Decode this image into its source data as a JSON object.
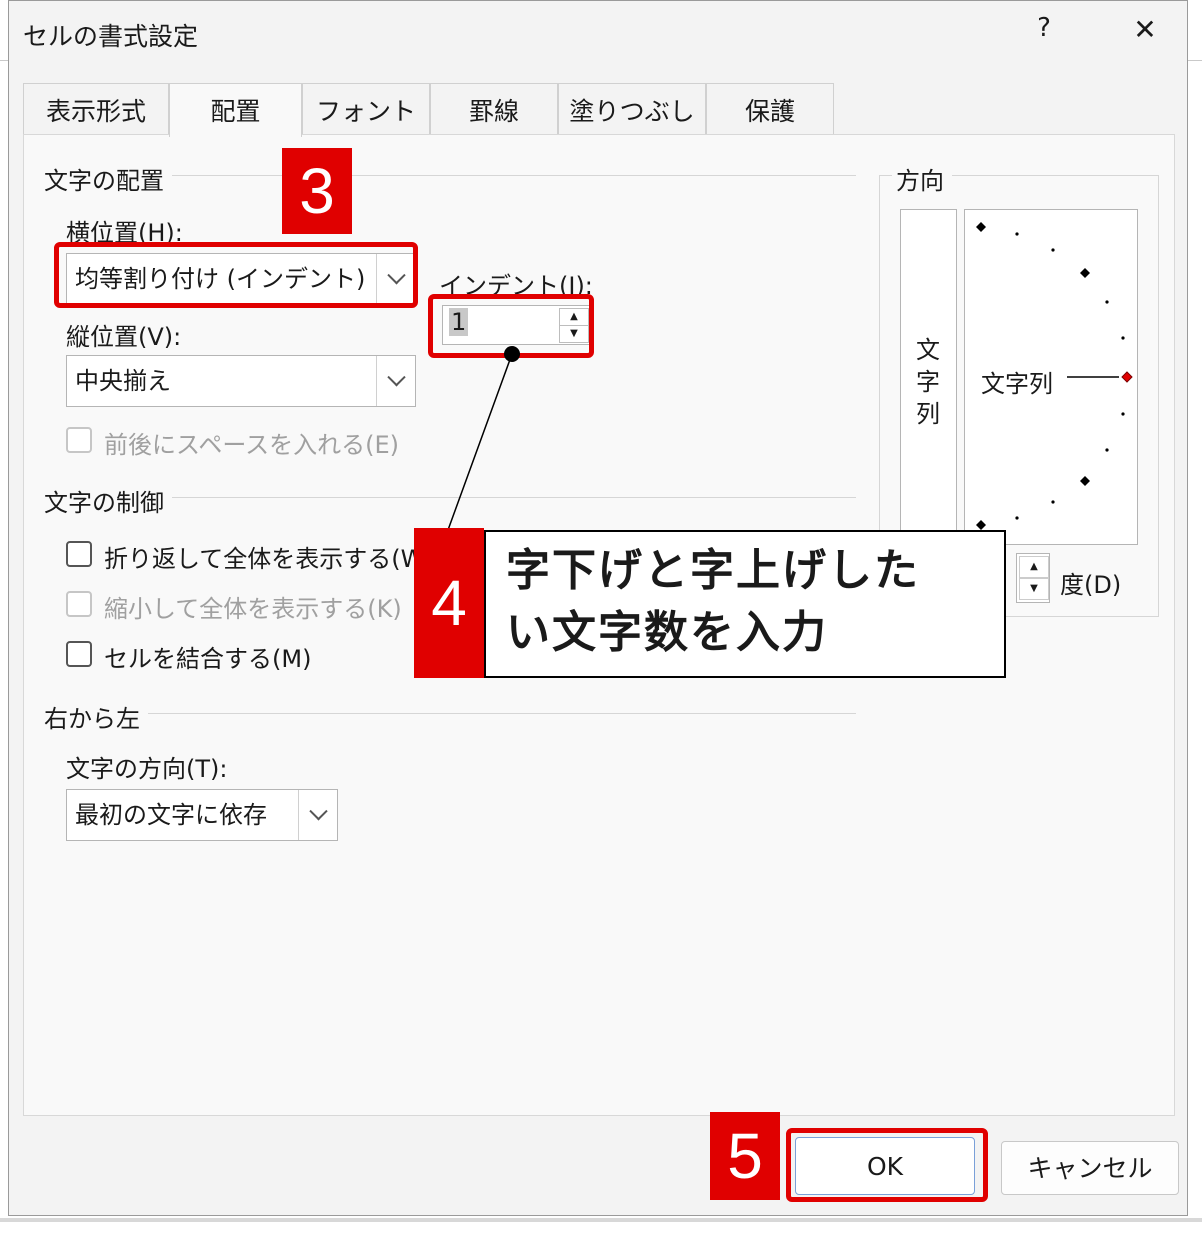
{
  "dialog": {
    "title": "セルの書式設定",
    "help_glyph": "?",
    "close_glyph": "✕"
  },
  "tabs": [
    "表示形式",
    "配置",
    "フォント",
    "罫線",
    "塗りつぶし",
    "保護"
  ],
  "active_tab": "配置",
  "alignment": {
    "group_title": "文字の配置",
    "horizontal_label": "横位置(H):",
    "horizontal_value": "均等割り付け (インデント)",
    "indent_label": "インデント(I):",
    "indent_value": "1",
    "vertical_label": "縦位置(V):",
    "vertical_value": "中央揃え",
    "add_space_label": "前後にスペースを入れる(E)"
  },
  "control": {
    "group_title": "文字の制御",
    "wrap_label": "折り返して全体を表示する(W)",
    "shrink_label": "縮小して全体を表示する(K)",
    "merge_label": "セルを結合する(M)"
  },
  "rtl": {
    "group_title": "右から左",
    "direction_label": "文字の方向(T):",
    "direction_value": "最初の文字に依存"
  },
  "orientation": {
    "group_title": "方向",
    "vertical_text": [
      "文",
      "字",
      "列"
    ],
    "dial_text": "文字列",
    "degree_label": "度(D)"
  },
  "buttons": {
    "ok": "OK",
    "cancel": "キャンセル"
  },
  "annotations": {
    "step3": "3",
    "step4": "4",
    "step4_callout": [
      "字下げと字上げした",
      "い文字数を入力"
    ],
    "step5": "5",
    "accent_color": "#e00000"
  }
}
